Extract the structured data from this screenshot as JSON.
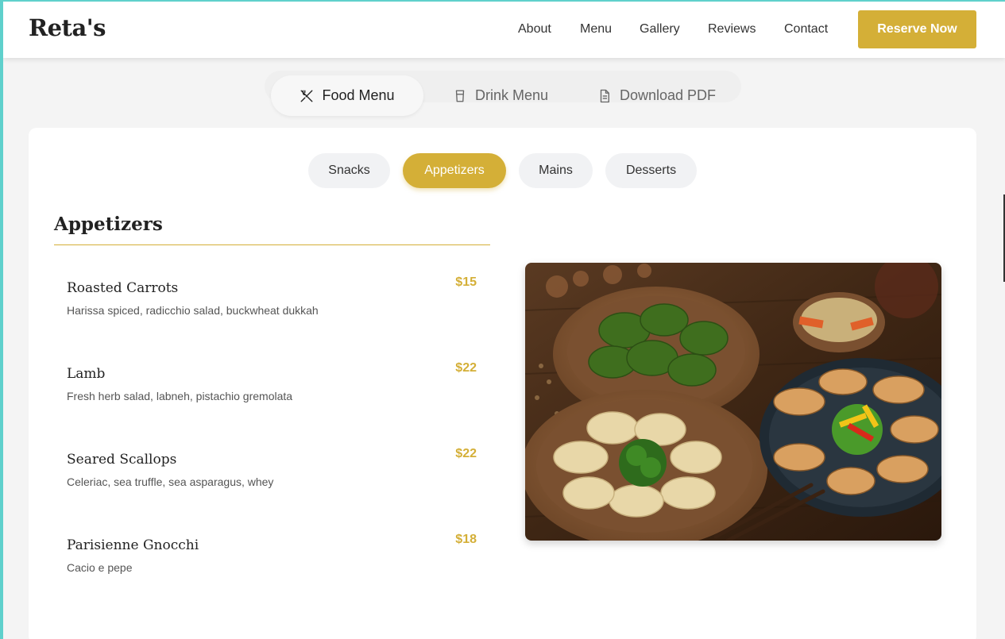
{
  "header": {
    "brand": "Reta's",
    "nav": [
      "About",
      "Menu",
      "Gallery",
      "Reviews",
      "Contact"
    ],
    "cta": "Reserve Now"
  },
  "menu_tabs": [
    {
      "label": "Food Menu",
      "icon": "utensils-icon",
      "active": true
    },
    {
      "label": "Drink Menu",
      "icon": "cup-icon",
      "active": false
    },
    {
      "label": "Download PDF",
      "icon": "document-icon",
      "active": false
    }
  ],
  "categories": [
    {
      "label": "Snacks",
      "active": false
    },
    {
      "label": "Appetizers",
      "active": true
    },
    {
      "label": "Mains",
      "active": false
    },
    {
      "label": "Desserts",
      "active": false
    }
  ],
  "section": {
    "title": "Appetizers",
    "items": [
      {
        "name": "Roasted Carrots",
        "price": "$15",
        "desc": "Harissa spiced, radicchio salad, buckwheat dukkah"
      },
      {
        "name": "Lamb",
        "price": "$22",
        "desc": "Fresh herb salad, labneh, pistachio gremolata"
      },
      {
        "name": "Seared Scallops",
        "price": "$22",
        "desc": "Celeriac, sea truffle, sea asparagus, whey"
      },
      {
        "name": "Parisienne Gnocchi",
        "price": "$18",
        "desc": "Cacio e pepe"
      }
    ]
  },
  "colors": {
    "accent": "#d4af37",
    "background": "#f4f4f4",
    "card": "#ffffff"
  }
}
